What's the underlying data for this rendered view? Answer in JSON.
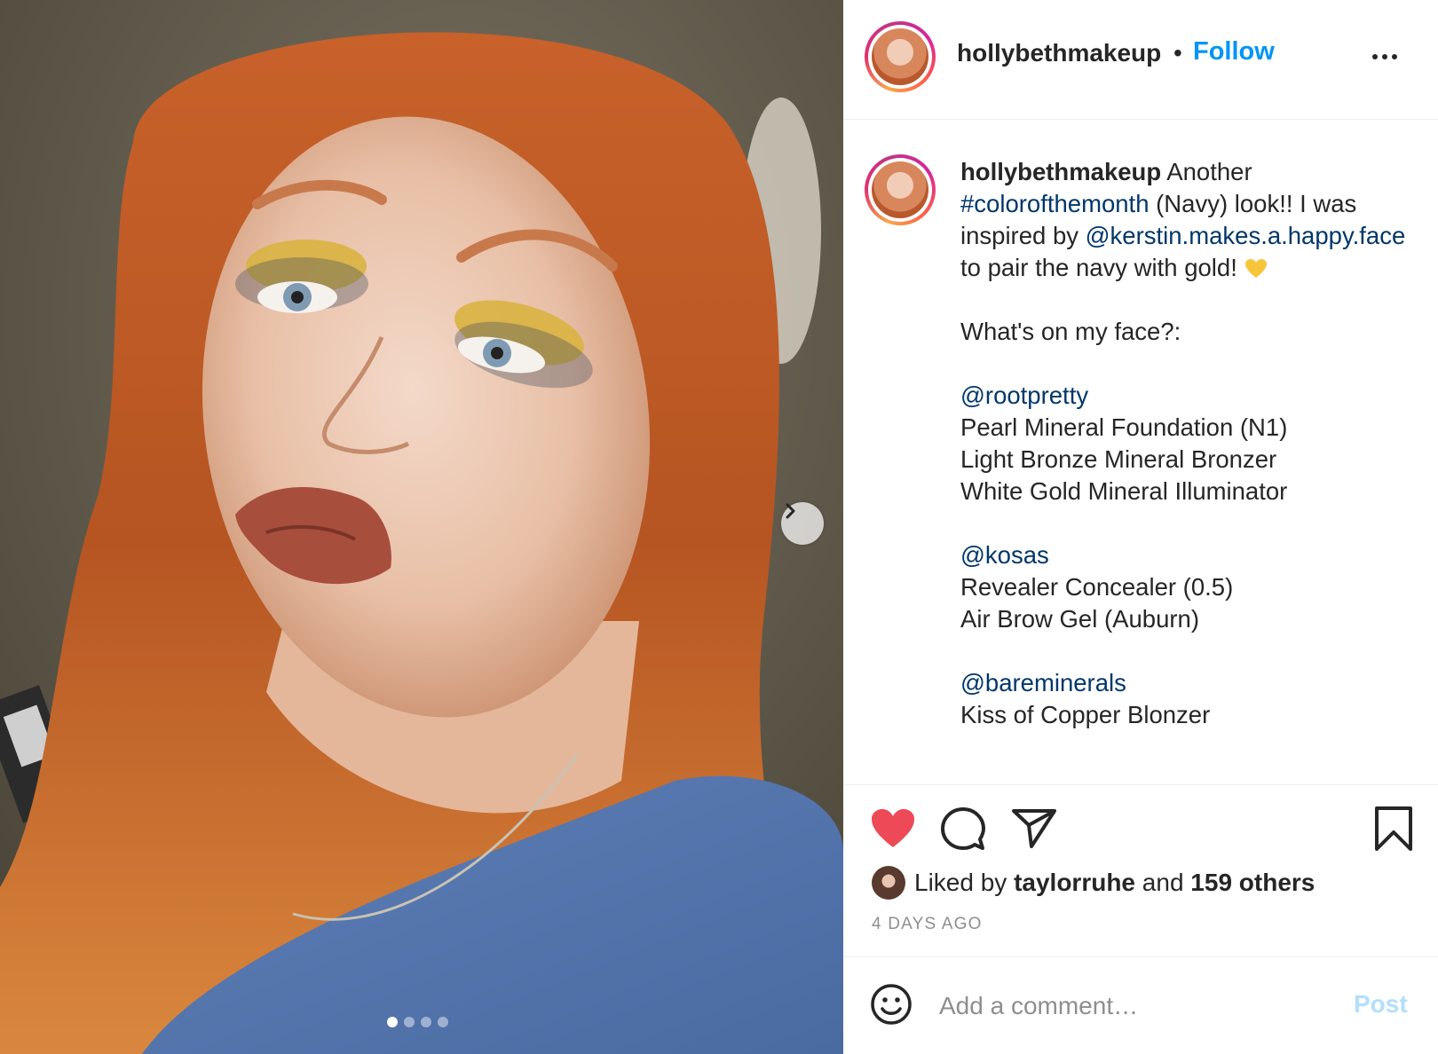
{
  "post": {
    "username": "hollybethmakeup",
    "separator": "•",
    "follow_label": "Follow",
    "more_icon": "more-horizontal-icon",
    "photo_alt": "selfie",
    "carousel": {
      "slides": 4,
      "active_index": 0
    }
  },
  "caption": {
    "username": "hollybethmakeup",
    "intro": " Another ",
    "hashtag": "#colorofthemonth",
    "line1_rest": " (Navy) look!! I was inspired by ",
    "mention1": "@kerstin.makes.a.happy.face",
    "line2_rest": " to pair the navy with gold! ",
    "whats_on": "What's on my face?:",
    "brand1": "@rootpretty",
    "brand1_items": [
      "Pearl Mineral Foundation (N1)",
      "Light Bronze Mineral Bronzer",
      "White Gold Mineral Illuminator"
    ],
    "brand2": "@kosas",
    "brand2_items": [
      "Revealer Concealer (0.5)",
      "Air Brow Gel (Auburn)"
    ],
    "brand3": "@bareminerals",
    "brand3_items": [
      "Kiss of Copper Blonzer"
    ]
  },
  "likes": {
    "prefix": "Liked by ",
    "liker": "taylorruhe",
    "middle": " and ",
    "others": "159 others"
  },
  "timestamp": "4 DAYS AGO",
  "comment": {
    "placeholder": "Add a comment…",
    "post_label": "Post"
  },
  "colors": {
    "follow": "#0095f6",
    "link": "#00376b",
    "liked_heart": "#ed4956",
    "post_disabled": "#b2dffc",
    "meta": "#8e8e8e"
  }
}
